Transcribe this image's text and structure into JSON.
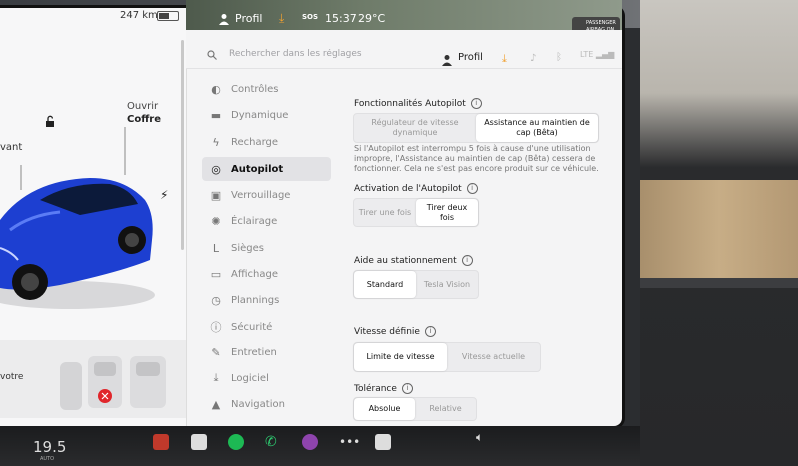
{
  "status_bar": {
    "profile_label": "Profil",
    "time": "15:37",
    "temperature": "29°C",
    "sos": "SOS",
    "airbag_label": "PASSENGER AIRBAG ON",
    "airbag_line1": "PASSENGER",
    "airbag_line2": "AIRBAG ON"
  },
  "car_panel": {
    "range": "247 km",
    "trunk_line1": "Ouvrir",
    "trunk_line2": "Coffre",
    "front_label": "vant",
    "seat_label": "votre"
  },
  "header": {
    "search_placeholder": "Rechercher dans les réglages",
    "profile_label": "Profil",
    "lte": "LTE"
  },
  "nav": {
    "items": [
      {
        "label": "Contrôles",
        "icon": "toggle-icon"
      },
      {
        "label": "Dynamique",
        "icon": "car-icon"
      },
      {
        "label": "Recharge",
        "icon": "bolt-icon"
      },
      {
        "label": "Autopilot",
        "icon": "steering-wheel-icon",
        "active": true
      },
      {
        "label": "Verrouillage",
        "icon": "lock-icon"
      },
      {
        "label": "Éclairage",
        "icon": "sun-icon"
      },
      {
        "label": "Sièges",
        "icon": "seat-icon"
      },
      {
        "label": "Affichage",
        "icon": "display-icon"
      },
      {
        "label": "Plannings",
        "icon": "clock-icon"
      },
      {
        "label": "Sécurité",
        "icon": "info-circle-icon"
      },
      {
        "label": "Entretien",
        "icon": "wrench-icon"
      },
      {
        "label": "Logiciel",
        "icon": "download-icon"
      },
      {
        "label": "Navigation",
        "icon": "navigation-icon"
      }
    ]
  },
  "autopilot": {
    "features_title": "Fonctionnalités Autopilot",
    "features_options": [
      "Régulateur de vitesse dynamique",
      "Assistance au maintien de cap (Bêta)"
    ],
    "features_selected": 1,
    "description": "Si l'Autopilot est interrompu 5 fois à cause d'une utilisation impropre, l'Assistance au maintien de cap (Bêta) cessera de fonctionner. Cela ne s'est pas encore produit sur ce véhicule.",
    "activation_title": "Activation de l'Autopilot",
    "activation_options": [
      "Tirer une fois",
      "Tirer deux fois"
    ],
    "activation_selected": 1,
    "parking_title": "Aide au stationnement",
    "parking_options": [
      "Standard",
      "Tesla Vision"
    ],
    "parking_selected": 0,
    "speed_title": "Vitesse définie",
    "speed_options": [
      "Limite de vitesse",
      "Vitesse actuelle"
    ],
    "speed_selected": 0,
    "tolerance_title": "Tolérance",
    "tolerance_options": [
      "Absolue",
      "Relative"
    ],
    "tolerance_selected": 0
  },
  "taskbar": {
    "speed": "19.5",
    "speed_sub": "AUTO"
  },
  "colors": {
    "accent": "#f0a030",
    "car_blue": "#1d3fd1",
    "spotify": "#1db954",
    "phone": "#2ecc71",
    "media": "#8e44ad",
    "red": "#e0262b"
  }
}
